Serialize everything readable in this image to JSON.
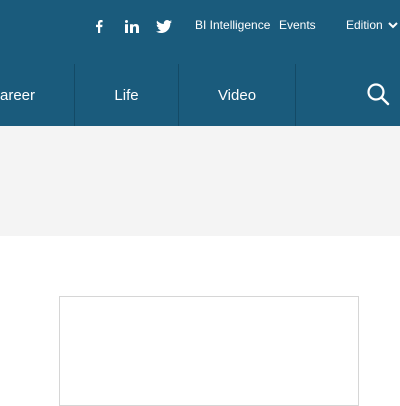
{
  "header": {
    "social": [
      {
        "icon": "facebook-icon"
      },
      {
        "icon": "linkedin-icon"
      },
      {
        "icon": "twitter-icon"
      }
    ],
    "links": {
      "bi_intelligence": "BI Intelligence",
      "events": "Events",
      "edition": "Edition"
    },
    "edition_icon": "chevron-down-icon"
  },
  "nav": {
    "items": [
      {
        "label": "areer"
      },
      {
        "label": "Life"
      },
      {
        "label": "Video"
      }
    ],
    "search_icon": "search-icon"
  },
  "colors": {
    "header_bg": "#1a5b7c",
    "band_bg": "#f4f4f4",
    "text": "#ffffff"
  }
}
